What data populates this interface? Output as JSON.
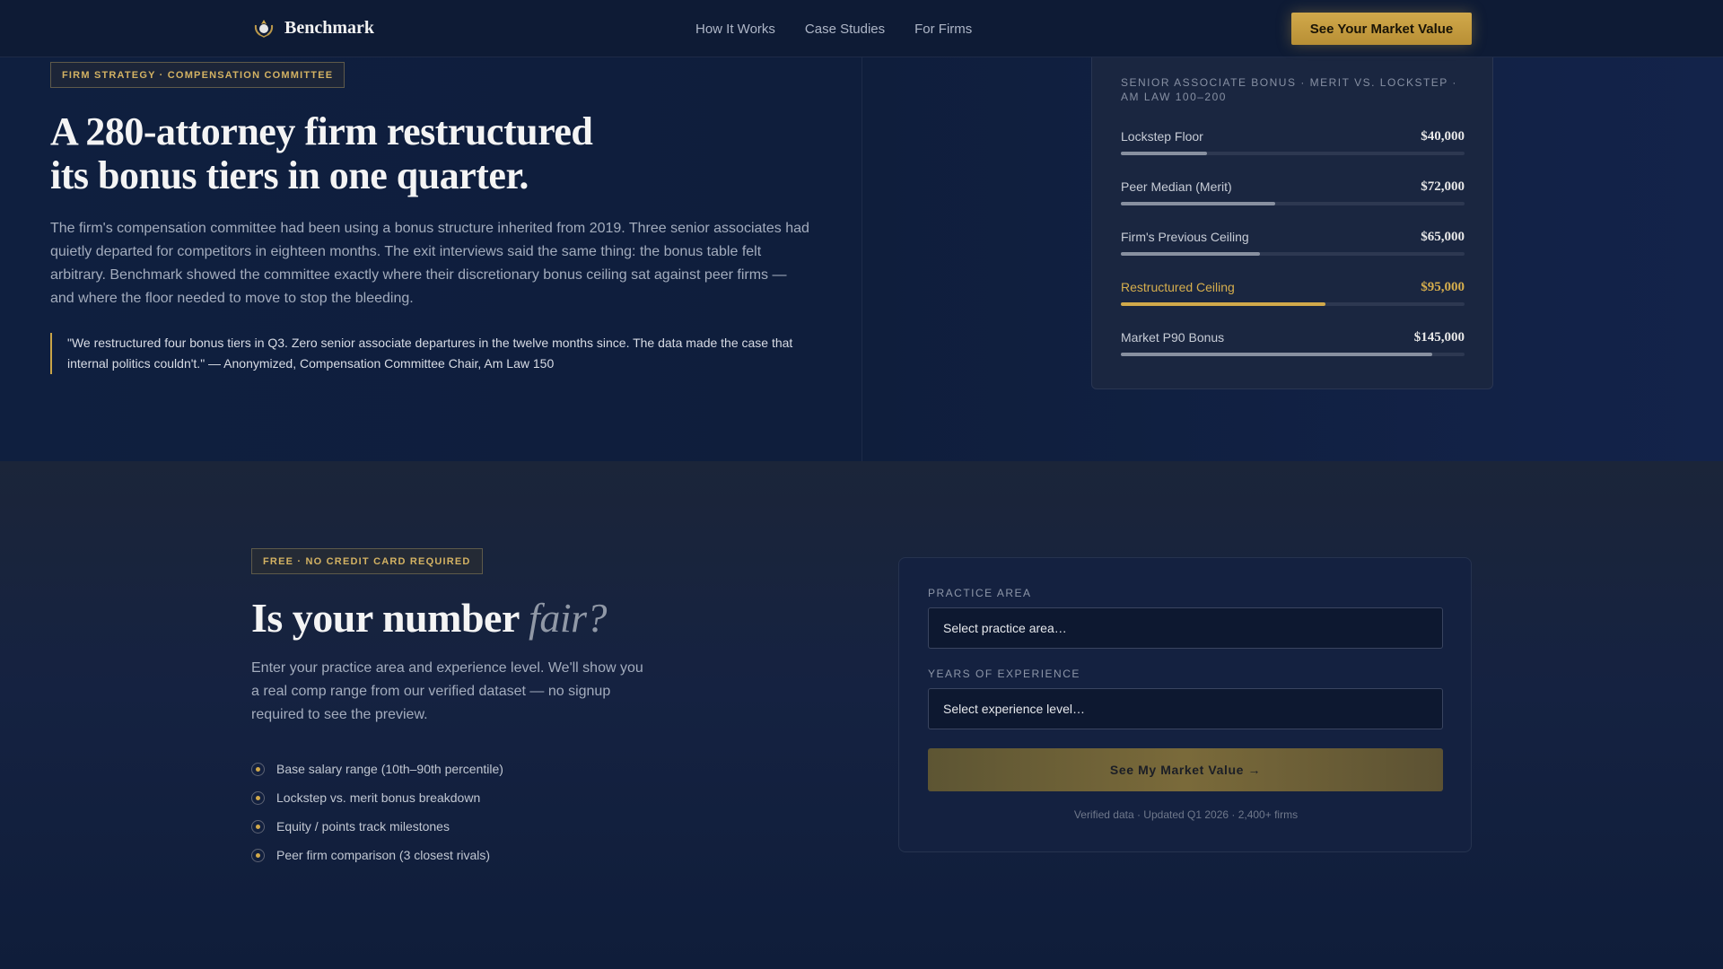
{
  "nav": {
    "logo_text": "Benchmark",
    "logo_icon": "laurel-crest-icon",
    "links": [
      "How It Works",
      "Case Studies",
      "For Firms"
    ],
    "cta_label": "See Your Market Value"
  },
  "hero": {
    "eyebrow": "FIRM STRATEGY · COMPENSATION COMMITTEE",
    "title_line1": "A 280-attorney firm restructured",
    "title_line2": "its bonus tiers in one quarter.",
    "body": "The firm's compensation committee had been using a bonus structure inherited from 2019. Three senior associates had quietly departed for competitors in eighteen months. The exit interviews said the same thing: the bonus table felt arbitrary. Benchmark showed the committee exactly where their discretionary bonus ceiling sat against peer firms — and where the floor needed to move to stop the bleeding.",
    "quote": "\"We restructured four bonus tiers in Q3. Zero senior associate departures in the twelve months since. The data made the case that internal politics couldn't.\" — Anonymized, Compensation Committee Chair, Am Law 150"
  },
  "bonus_card": {
    "title": "SENIOR ASSOCIATE BONUS · MERIT VS. LOCKSTEP · AM LAW 100–200",
    "rows": [
      {
        "label": "Lockstep Floor",
        "value": "$40,000",
        "fill_pct": 25
      },
      {
        "label": "Peer Median (Merit)",
        "value": "$72,000",
        "fill_pct": 45
      },
      {
        "label": "Firm's Previous Ceiling",
        "value": "$65,000",
        "fill_pct": 40.5
      },
      {
        "label": "Restructured Ceiling",
        "value": "$95,000",
        "fill_pct": 59.5
      },
      {
        "label": "Market P90 Bonus",
        "value": "$145,000",
        "fill_pct": 90.5
      }
    ],
    "highlight_color": "#d1a94b"
  },
  "lower": {
    "eyebrow": "FREE · NO CREDIT CARD REQUIRED",
    "title_main": "Is your number",
    "title_accent": "fair?",
    "body": "Enter your practice area and experience level. We'll show you a real comp range from our verified dataset — no signup required to see the preview.",
    "features": [
      "Base salary range (10th–90th percentile)",
      "Lockstep vs. merit bonus breakdown",
      "Equity / points track milestones",
      "Peer firm comparison (3 closest rivals)"
    ]
  },
  "form": {
    "practice_label": "PRACTICE AREA",
    "practice_value": "Select practice area…",
    "experience_label": "YEARS OF EXPERIENCE",
    "experience_value": "Select experience level…",
    "submit_label": "See My Market Value →",
    "footnote": "Verified data · Updated Q1 2026 · 2,400+ firms"
  }
}
